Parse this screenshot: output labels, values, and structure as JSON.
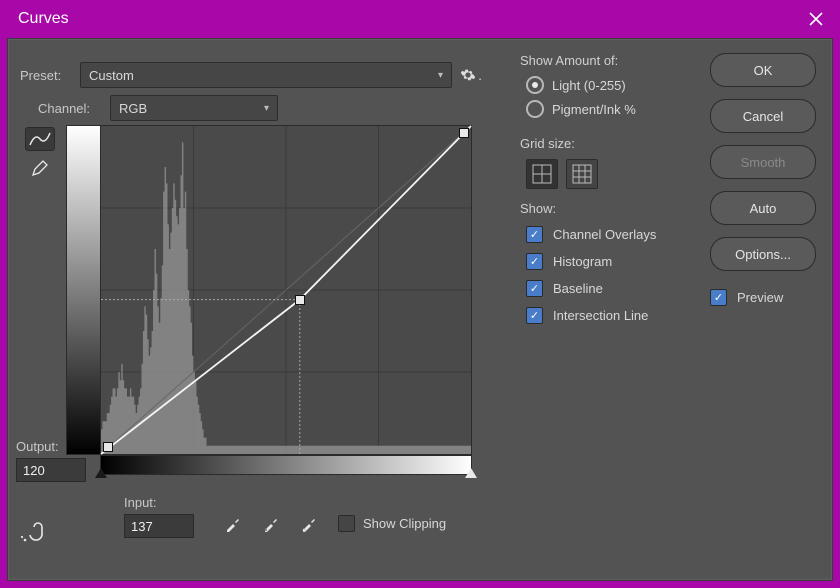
{
  "title": "Curves",
  "preset": {
    "label": "Preset:",
    "value": "Custom"
  },
  "channel": {
    "label": "Channel:",
    "value": "RGB"
  },
  "output": {
    "label": "Output:",
    "value": "120"
  },
  "input": {
    "label": "Input:",
    "value": "137"
  },
  "show_clipping": {
    "label": "Show Clipping",
    "checked": false
  },
  "show_amount": {
    "title": "Show Amount of:",
    "light": {
      "label": "Light  (0-255)",
      "selected": true
    },
    "pigment": {
      "label": "Pigment/Ink %",
      "selected": false
    }
  },
  "grid": {
    "title": "Grid size:",
    "selected": "coarse"
  },
  "show": {
    "title": "Show:",
    "items": [
      {
        "label": "Channel Overlays",
        "checked": true
      },
      {
        "label": "Histogram",
        "checked": true
      },
      {
        "label": "Baseline",
        "checked": true
      },
      {
        "label": "Intersection Line",
        "checked": true
      }
    ]
  },
  "buttons": {
    "ok": "OK",
    "cancel": "Cancel",
    "smooth": "Smooth",
    "auto": "Auto",
    "options": "Options..."
  },
  "preview": {
    "label": "Preview",
    "checked": true
  },
  "chart_data": {
    "type": "line",
    "title": "Curves",
    "xlabel": "Input",
    "ylabel": "Output",
    "xlim": [
      0,
      255
    ],
    "ylim": [
      0,
      255
    ],
    "series": [
      {
        "name": "baseline",
        "x": [
          0,
          255
        ],
        "y": [
          0,
          255
        ]
      },
      {
        "name": "curve",
        "x": [
          0,
          137,
          255
        ],
        "y": [
          0,
          120,
          255
        ]
      }
    ],
    "histogram": [
      3,
      4,
      4,
      4,
      5,
      5,
      6,
      7,
      8,
      8,
      7,
      8,
      10,
      9,
      11,
      9,
      8,
      8,
      7,
      7,
      8,
      7,
      7,
      6,
      5,
      6,
      7,
      8,
      11,
      15,
      18,
      17,
      14,
      12,
      13,
      15,
      20,
      25,
      22,
      18,
      16,
      19,
      23,
      32,
      35,
      33,
      28,
      25,
      27,
      30,
      33,
      31,
      29,
      28,
      30,
      34,
      38,
      30,
      32,
      25,
      20,
      18,
      16,
      12,
      10,
      9,
      7,
      6,
      5,
      4,
      3,
      2,
      2,
      1,
      1,
      1,
      1,
      1,
      1,
      1,
      1,
      1,
      1,
      1,
      1,
      1,
      1,
      1,
      1,
      1,
      1,
      1,
      1,
      1,
      1,
      1,
      1,
      1,
      1,
      1,
      1,
      1,
      1,
      1,
      1,
      1,
      1,
      1,
      1,
      1,
      1,
      1,
      1,
      1,
      1,
      1,
      1,
      1,
      1,
      1,
      1,
      1,
      1,
      1,
      1,
      1,
      1,
      1,
      1,
      1,
      1,
      1,
      1,
      1,
      1,
      1,
      1,
      1,
      1,
      1,
      1,
      1,
      1,
      1,
      1,
      1,
      1,
      1,
      1,
      1,
      1,
      1,
      1,
      1,
      1,
      1,
      1,
      1,
      1,
      1,
      1,
      1,
      1,
      1,
      1,
      1,
      1,
      1,
      1,
      1,
      1,
      1,
      1,
      1,
      1,
      1,
      1,
      1,
      1,
      1,
      1,
      1,
      1,
      1,
      1,
      1,
      1,
      1,
      1,
      1,
      1,
      1,
      1,
      1,
      1,
      1,
      1,
      1,
      1,
      1,
      1,
      1,
      1,
      1,
      1,
      1,
      1,
      1,
      1,
      1,
      1,
      1,
      1,
      1,
      1,
      1,
      1,
      1,
      1,
      1,
      1,
      1,
      1,
      1,
      1,
      1,
      1,
      1,
      1,
      1,
      1,
      1,
      1,
      1,
      1,
      1,
      1,
      1,
      1,
      1,
      1,
      1,
      1,
      1,
      1,
      1,
      1,
      1,
      1,
      1,
      1,
      1,
      1,
      1,
      1,
      1
    ]
  }
}
